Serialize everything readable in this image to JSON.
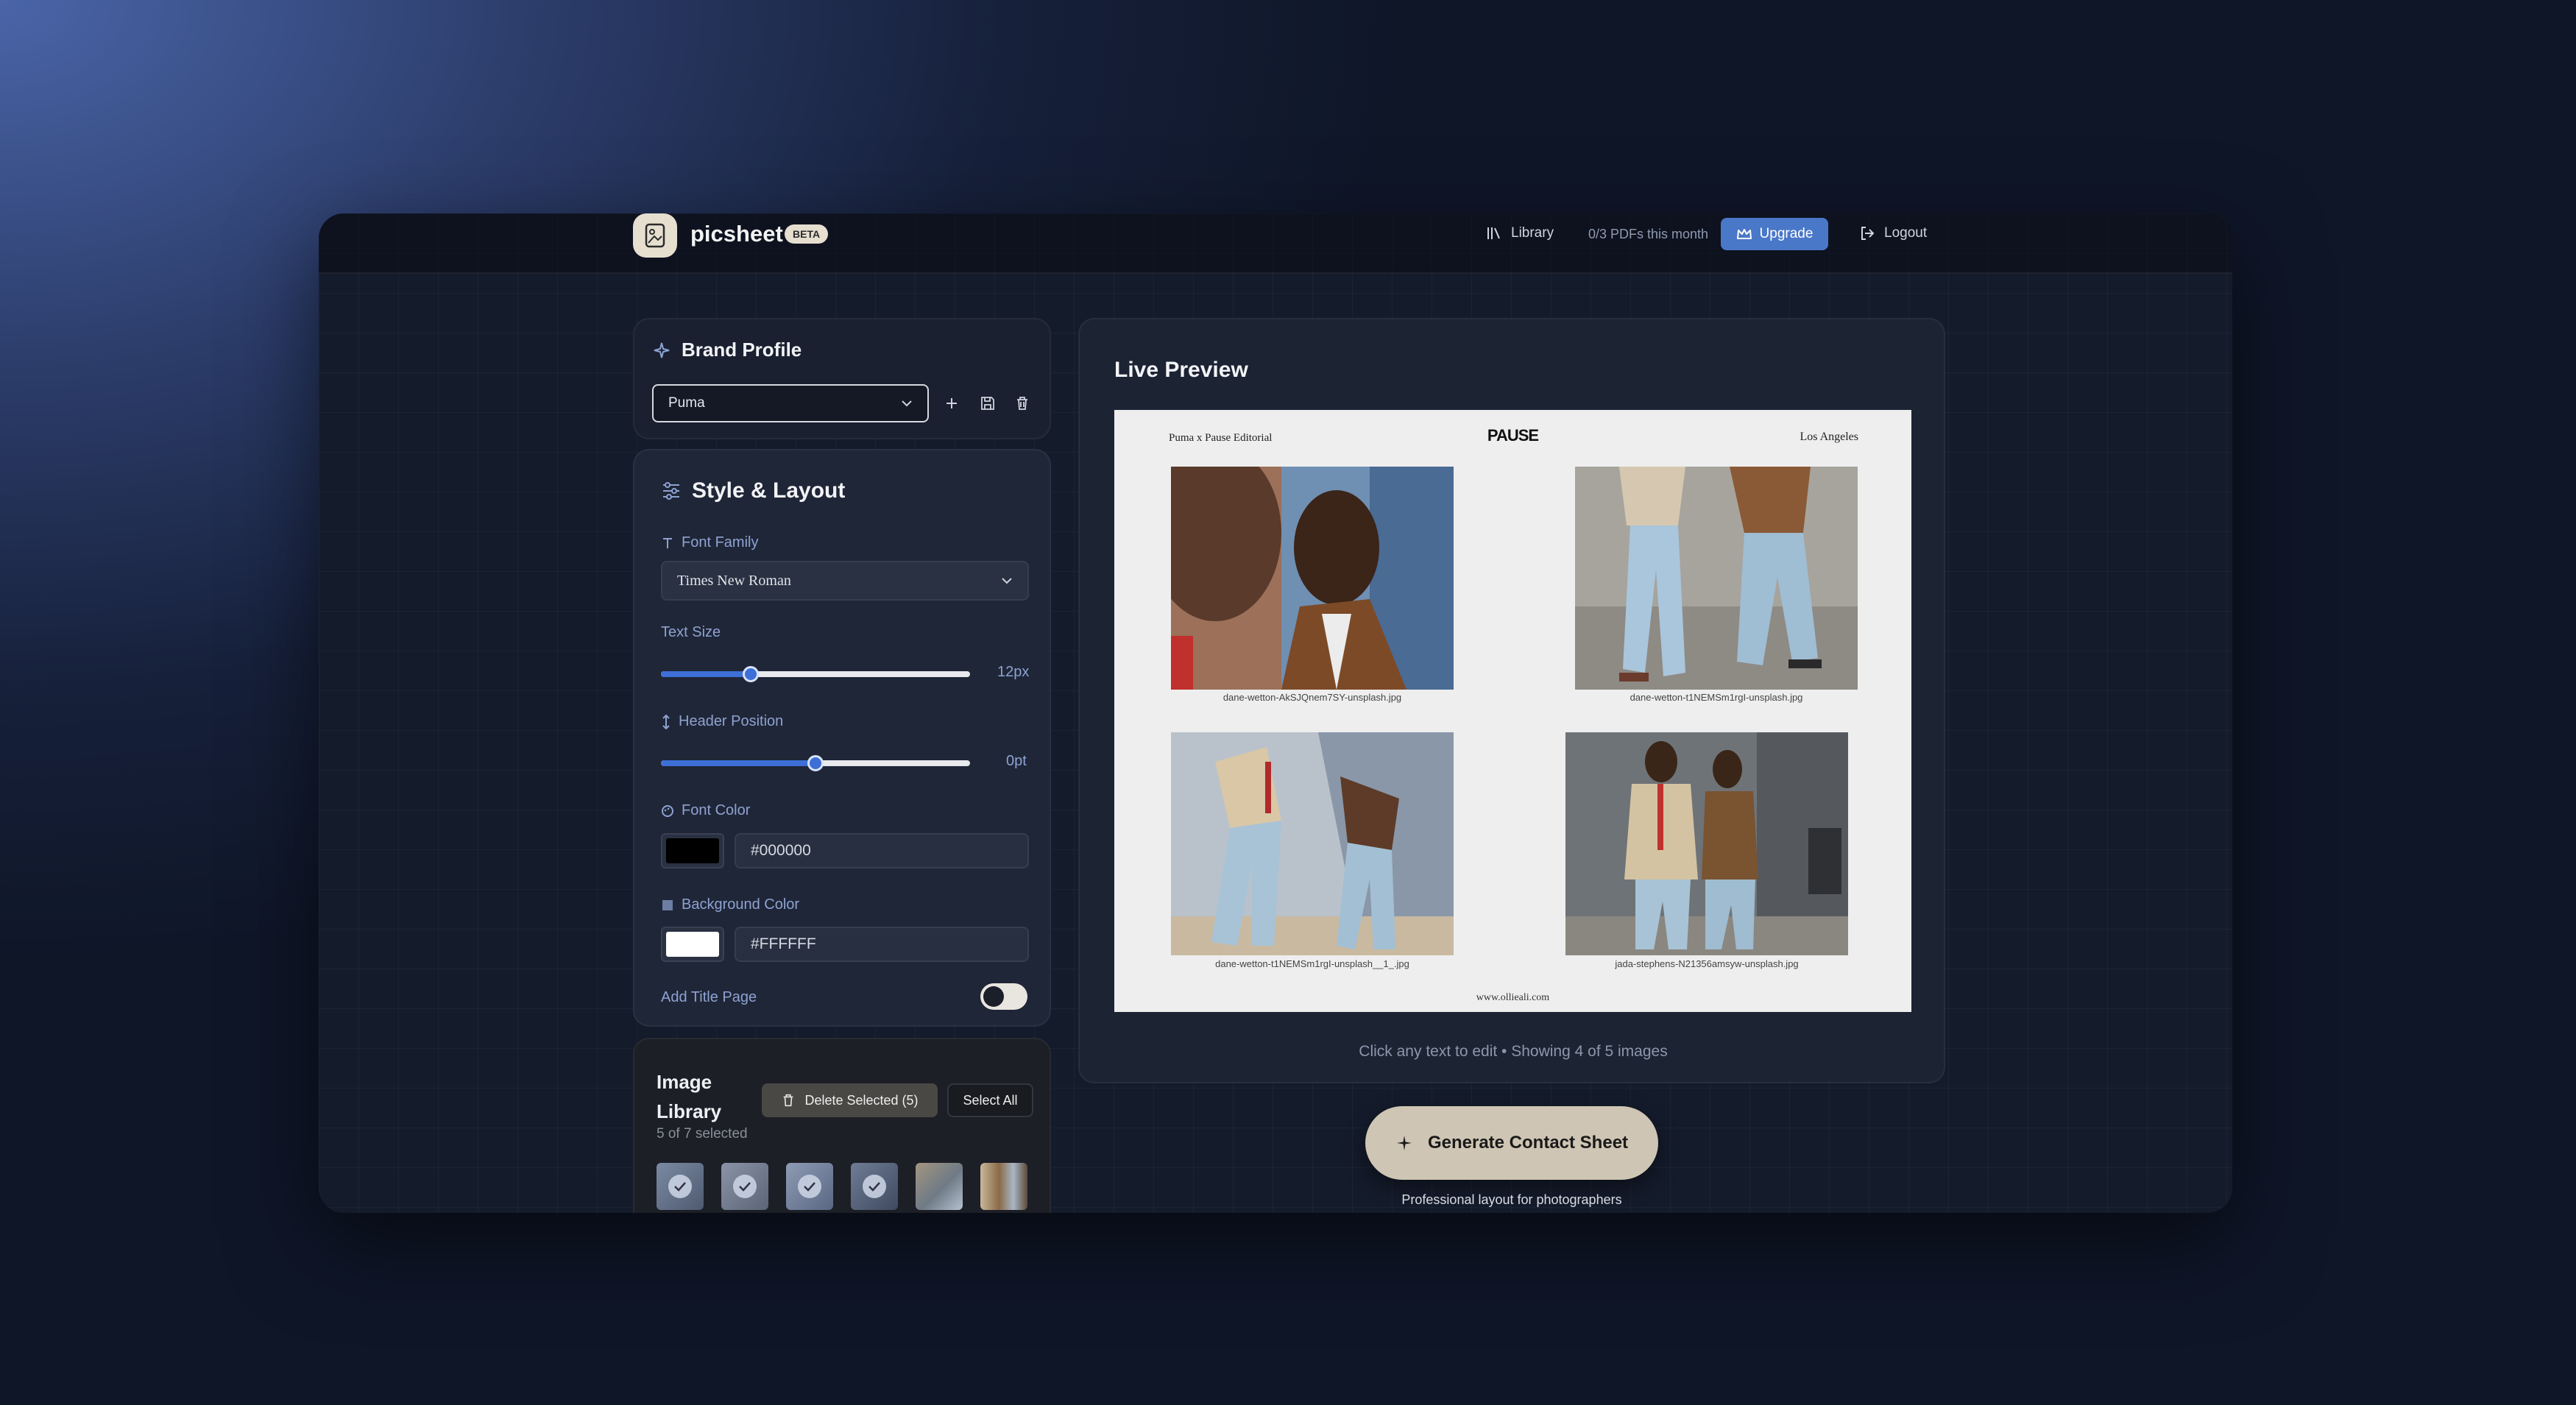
{
  "header": {
    "brand_name": "picsheet",
    "beta_badge": "BETA",
    "library_label": "Library",
    "pdf_count": "0/3 PDFs this month",
    "upgrade_label": "Upgrade",
    "logout_label": "Logout"
  },
  "brand_profile": {
    "title": "Brand Profile",
    "selected_profile": "Puma"
  },
  "style_layout": {
    "title": "Style & Layout",
    "font_family_label": "Font Family",
    "font_family_value": "Times New Roman",
    "text_size_label": "Text Size",
    "text_size_value": "12px",
    "text_size_fraction": 0.29,
    "header_position_label": "Header Position",
    "header_position_value": "0pt",
    "header_position_fraction": 0.5,
    "font_color_label": "Font Color",
    "font_color_value": "#000000",
    "background_color_label": "Background Color",
    "background_color_value": "#FFFFFF",
    "add_title_page_label": "Add Title Page",
    "add_title_page_on": false
  },
  "image_library": {
    "title": "Image Library",
    "selected_count": "5 of 7 selected",
    "delete_selected_label": "Delete Selected (5)",
    "select_all_label": "Select All"
  },
  "live_preview": {
    "title": "Live Preview",
    "sheet_header_left": "Puma x Pause Editorial",
    "sheet_header_center": "PAUSE",
    "sheet_header_right": "Los Angeles",
    "captions": [
      "dane-wetton-AkSJQnem7SY-unsplash.jpg",
      "dane-wetton-t1NEMSm1rgI-unsplash.jpg",
      "dane-wetton-t1NEMSm1rgI-unsplash__1_.jpg",
      "jada-stephens-N21356amsyw-unsplash.jpg"
    ],
    "sheet_footer": "www.ollieali.com",
    "note": "Click any text to edit • Showing 4 of 5 images"
  },
  "actions": {
    "generate_label": "Generate Contact Sheet",
    "generate_sub": "Professional layout for photographers"
  },
  "colors": {
    "accent_blue": "#3d6fd6",
    "upgrade_blue": "#4a78c8",
    "beige": "#cfc5b4"
  }
}
